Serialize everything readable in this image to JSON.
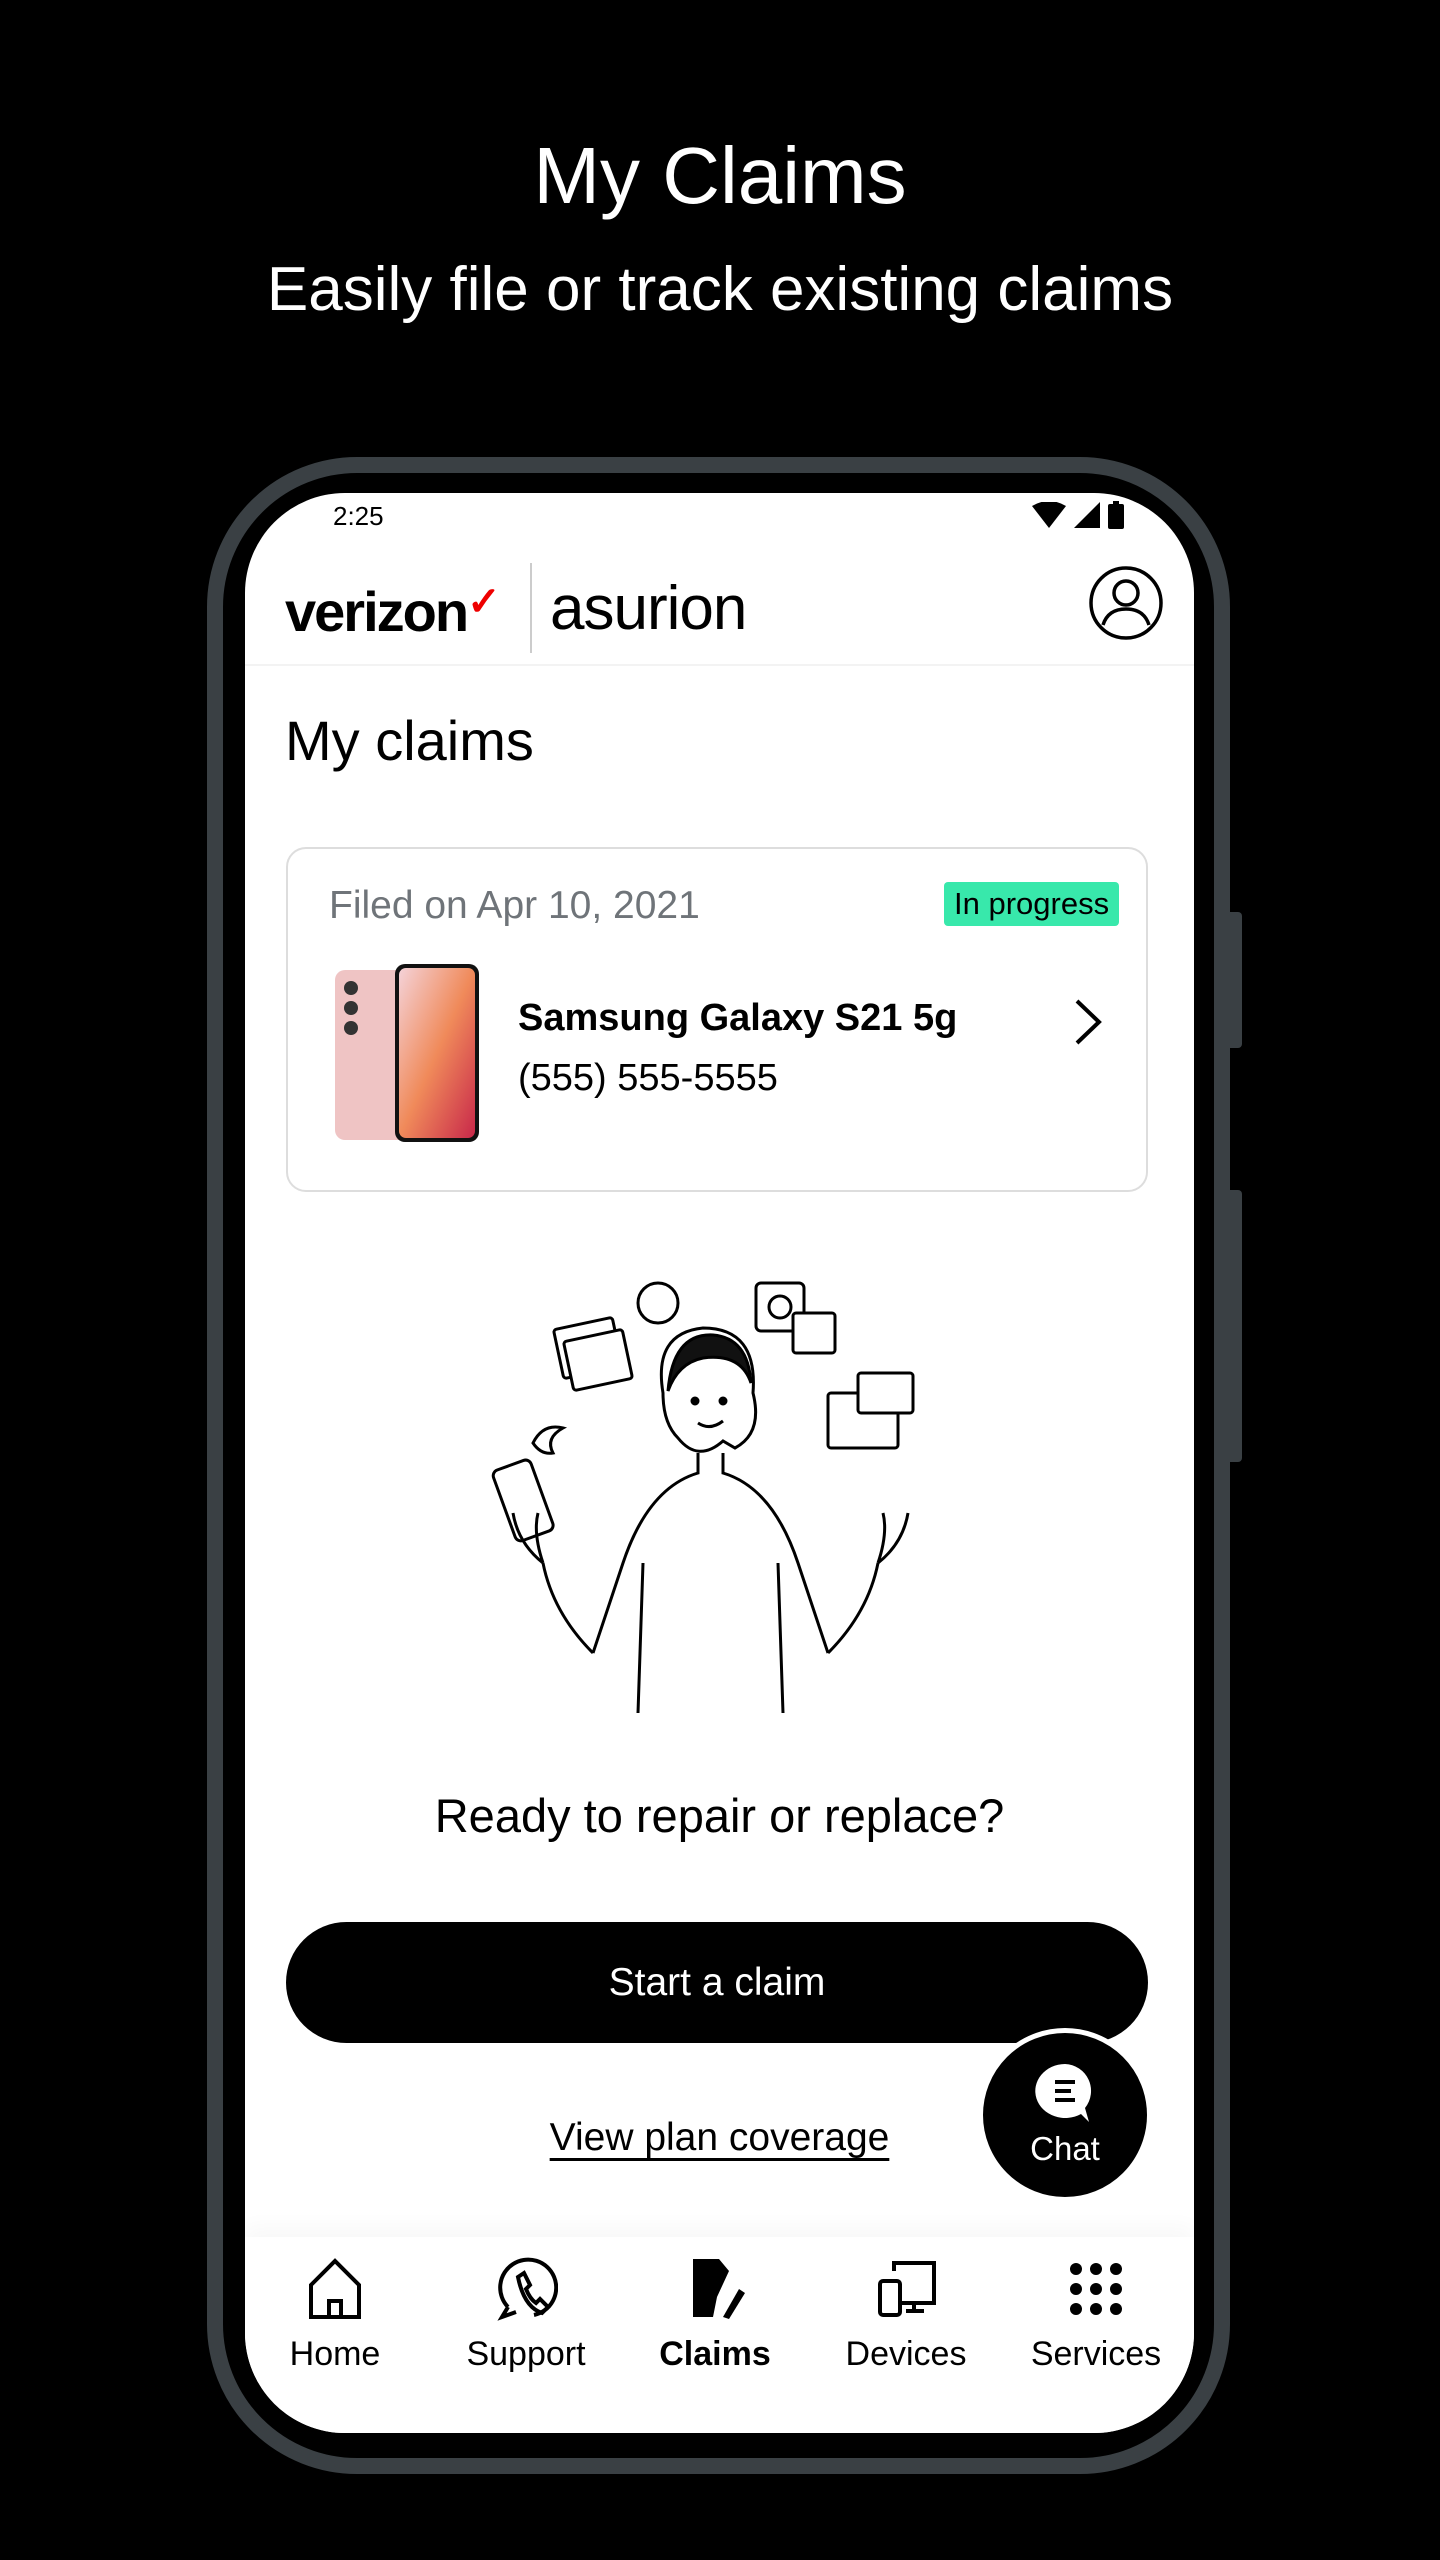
{
  "hero": {
    "title": "My Claims",
    "subtitle": "Easily file or track existing claims"
  },
  "status_bar": {
    "time": "2:25",
    "icons": [
      "wifi-icon",
      "signal-icon",
      "battery-icon"
    ]
  },
  "header": {
    "brand_left": "verizon",
    "brand_right": "asurion",
    "profile_icon": "account-circle-icon"
  },
  "page": {
    "title": "My claims"
  },
  "claim": {
    "filed": "Filed on Apr 10, 2021",
    "status": "In progress",
    "status_color": "#38e8ab",
    "device": "Samsung Galaxy S21 5g",
    "phone": "(555) 555-5555"
  },
  "prompt": "Ready to repair or replace?",
  "start_button": "Start a claim",
  "coverage_link": "View plan coverage",
  "chat": {
    "label": "Chat"
  },
  "nav": {
    "items": [
      {
        "label": "Home",
        "icon": "home-icon"
      },
      {
        "label": "Support",
        "icon": "support-icon"
      },
      {
        "label": "Claims",
        "icon": "claims-icon",
        "active": true
      },
      {
        "label": "Devices",
        "icon": "devices-icon"
      },
      {
        "label": "Services",
        "icon": "grid-icon"
      }
    ]
  }
}
